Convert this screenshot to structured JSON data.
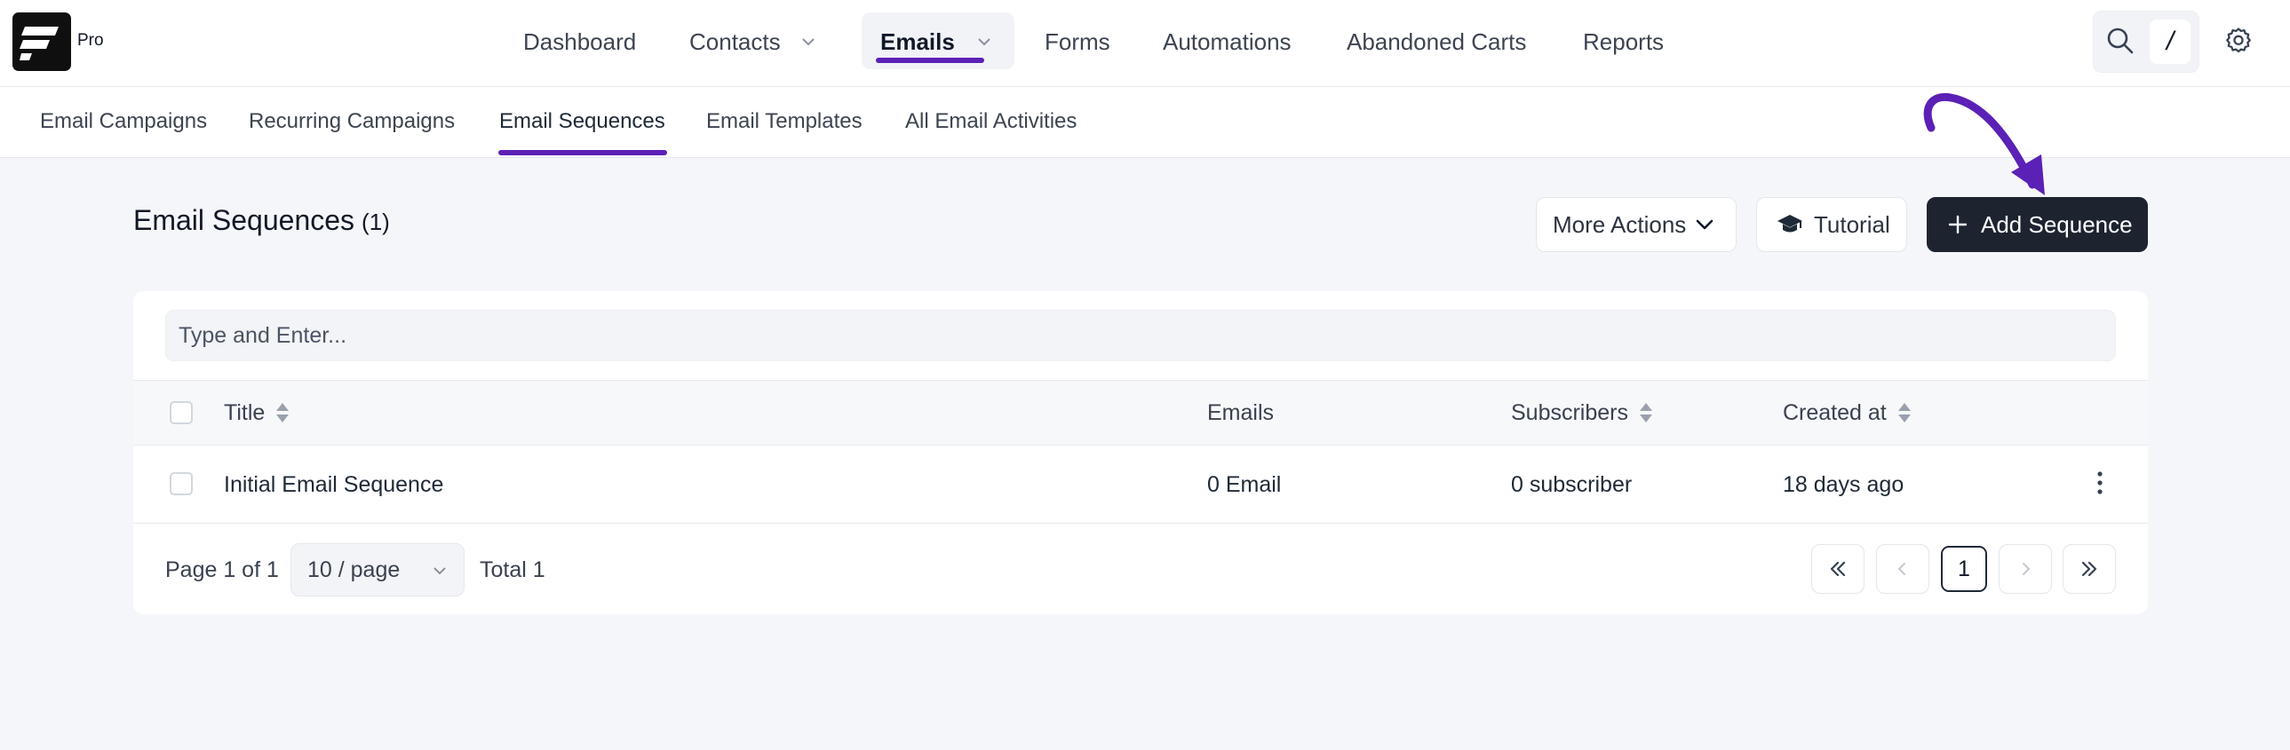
{
  "app": {
    "badge": "Pro"
  },
  "nav": {
    "items": [
      {
        "label": "Dashboard"
      },
      {
        "label": "Contacts"
      },
      {
        "label": "Emails"
      },
      {
        "label": "Forms"
      },
      {
        "label": "Automations"
      },
      {
        "label": "Abandoned Carts"
      },
      {
        "label": "Reports"
      }
    ],
    "active": "Emails",
    "search_shortcut": "/"
  },
  "subnav": {
    "items": [
      {
        "label": "Email Campaigns"
      },
      {
        "label": "Recurring Campaigns"
      },
      {
        "label": "Email Sequences"
      },
      {
        "label": "Email Templates"
      },
      {
        "label": "All Email Activities"
      }
    ],
    "active": "Email Sequences"
  },
  "page": {
    "title": "Email Sequences",
    "count": "(1)",
    "more_actions_label": "More Actions",
    "tutorial_label": "Tutorial",
    "add_label": "Add Sequence"
  },
  "table": {
    "search_placeholder": "Type and Enter...",
    "columns": {
      "title": "Title",
      "emails": "Emails",
      "subscribers": "Subscribers",
      "created_at": "Created at"
    },
    "rows": [
      {
        "title": "Initial Email Sequence",
        "emails": "0 Email",
        "subscribers": "0 subscriber",
        "created_at": "18 days ago"
      }
    ]
  },
  "pagination": {
    "page_info": "Page 1 of 1",
    "per_page": "10 / page",
    "total": "Total 1",
    "current": "1"
  },
  "colors": {
    "accent": "#5b21b6",
    "primary_button": "#1d2430",
    "background": "#f5f6fa"
  }
}
